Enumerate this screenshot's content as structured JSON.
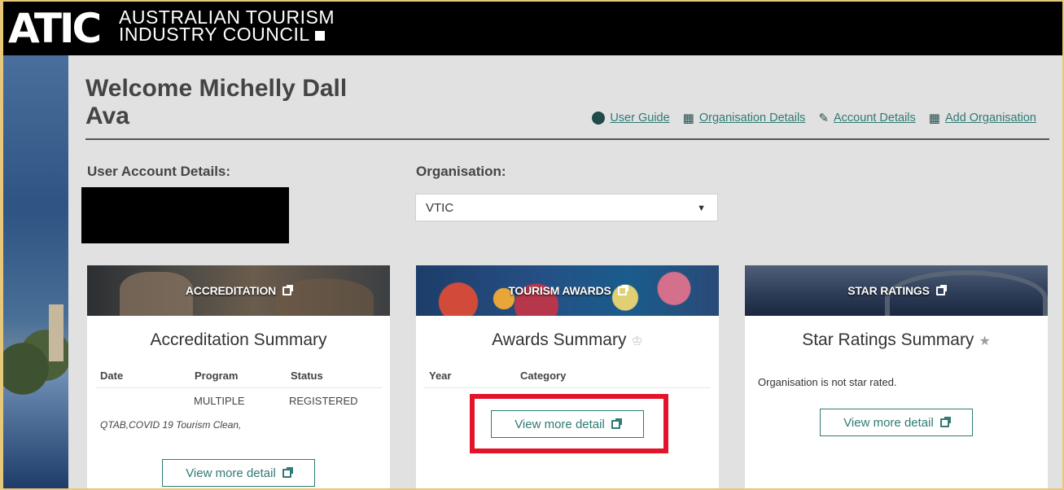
{
  "header": {
    "logo_mark": "ATIC",
    "logo_line1": "AUSTRALIAN TOURISM",
    "logo_line2": "INDUSTRY COUNCIL"
  },
  "welcome": {
    "line1": "Welcome Michelly Dall",
    "line2": "Ava"
  },
  "nav": {
    "user_guide": "User Guide",
    "organisation_details": "Organisation Details",
    "account_details": "Account Details",
    "add_organisation": "Add Organisation"
  },
  "user_account": {
    "label": "User Account Details:"
  },
  "organisation": {
    "label": "Organisation:",
    "selected": "VTIC"
  },
  "cards": {
    "accreditation": {
      "banner": "ACCREDITATION",
      "title": "Accreditation Summary",
      "columns": [
        "Date",
        "Program",
        "Status"
      ],
      "row": {
        "program": "MULTIPLE",
        "status": "REGISTERED"
      },
      "note": "QTAB,COVID 19 Tourism Clean,",
      "button": "View more detail"
    },
    "awards": {
      "banner": "TOURISM AWARDS",
      "title": "Awards Summary",
      "columns": [
        "Year",
        "Category"
      ],
      "button": "View more detail"
    },
    "stars": {
      "banner": "STAR RATINGS",
      "title": "Star Ratings Summary",
      "note": "Organisation is not star rated.",
      "button": "View more detail"
    }
  },
  "icons": {
    "help": "question-circle-icon",
    "building": "building-icon",
    "pencil": "pencil-icon",
    "add_org": "add-building-icon",
    "external": "external-link-icon",
    "award": "award-ribbon-icon",
    "star": "star-icon"
  },
  "colors": {
    "accent": "#2f7a74",
    "highlight": "#e3142a",
    "header_bg": "#000000"
  }
}
